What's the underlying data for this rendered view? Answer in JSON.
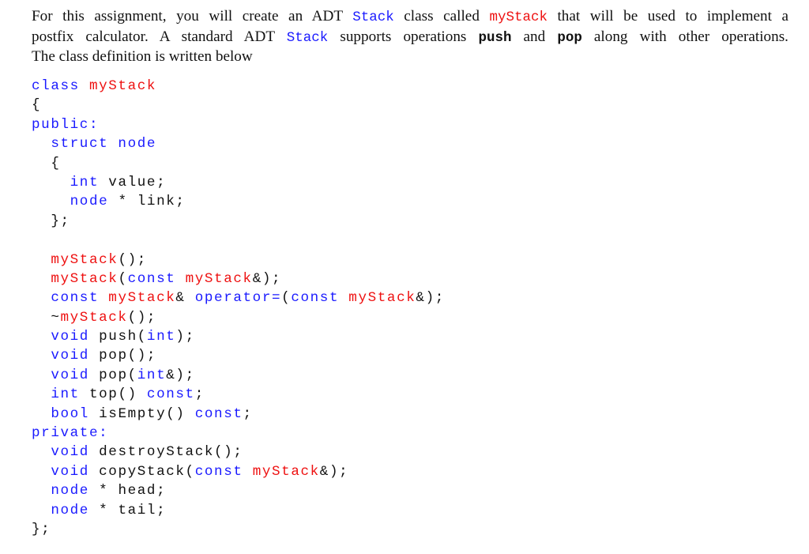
{
  "intro": {
    "line1": [
      {
        "text": "For this assignment, you will create an ADT ",
        "style": "text"
      },
      {
        "text": "Stack",
        "style": "blue"
      },
      {
        "text": " class called ",
        "style": "text"
      },
      {
        "text": "myStack",
        "style": "red"
      },
      {
        "text": " that will be used to implement a",
        "style": "text"
      }
    ],
    "line2": [
      {
        "text": "postfix calculator.  A standard ADT ",
        "style": "text"
      },
      {
        "text": "Stack",
        "style": "blue"
      },
      {
        "text": " supports operations ",
        "style": "text"
      },
      {
        "text": "push",
        "style": "bold"
      },
      {
        "text": " and ",
        "style": "text"
      },
      {
        "text": "pop",
        "style": "bold"
      },
      {
        "text": " along with other operations.",
        "style": "text"
      }
    ],
    "line3": [
      {
        "text": "The class definition is written below",
        "style": "text"
      }
    ]
  },
  "code_lines": [
    [
      {
        "t": "class ",
        "c": "blue"
      },
      {
        "t": "myStack",
        "c": "red"
      }
    ],
    [
      {
        "t": "{",
        "c": "black"
      }
    ],
    [
      {
        "t": "public:",
        "c": "blue"
      }
    ],
    [
      {
        "t": "  ",
        "c": "black"
      },
      {
        "t": "struct node",
        "c": "blue"
      }
    ],
    [
      {
        "t": "  {",
        "c": "black"
      }
    ],
    [
      {
        "t": "    ",
        "c": "black"
      },
      {
        "t": "int",
        "c": "blue"
      },
      {
        "t": " value;",
        "c": "black"
      }
    ],
    [
      {
        "t": "    ",
        "c": "black"
      },
      {
        "t": "node",
        "c": "blue"
      },
      {
        "t": " * link;",
        "c": "black"
      }
    ],
    [
      {
        "t": "  };",
        "c": "black"
      }
    ],
    [
      {
        "t": "",
        "c": "black"
      }
    ],
    [
      {
        "t": "  ",
        "c": "black"
      },
      {
        "t": "myStack",
        "c": "red"
      },
      {
        "t": "();",
        "c": "black"
      }
    ],
    [
      {
        "t": "  ",
        "c": "black"
      },
      {
        "t": "myStack",
        "c": "red"
      },
      {
        "t": "(",
        "c": "black"
      },
      {
        "t": "const",
        "c": "blue"
      },
      {
        "t": " ",
        "c": "black"
      },
      {
        "t": "myStack",
        "c": "red"
      },
      {
        "t": "&);",
        "c": "black"
      }
    ],
    [
      {
        "t": "  ",
        "c": "black"
      },
      {
        "t": "const",
        "c": "blue"
      },
      {
        "t": " ",
        "c": "black"
      },
      {
        "t": "myStack",
        "c": "red"
      },
      {
        "t": "& ",
        "c": "black"
      },
      {
        "t": "operator=",
        "c": "blue"
      },
      {
        "t": "(",
        "c": "black"
      },
      {
        "t": "const",
        "c": "blue"
      },
      {
        "t": " ",
        "c": "black"
      },
      {
        "t": "myStack",
        "c": "red"
      },
      {
        "t": "&);",
        "c": "black"
      }
    ],
    [
      {
        "t": "  ~",
        "c": "black"
      },
      {
        "t": "myStack",
        "c": "red"
      },
      {
        "t": "();",
        "c": "black"
      }
    ],
    [
      {
        "t": "  ",
        "c": "black"
      },
      {
        "t": "void",
        "c": "blue"
      },
      {
        "t": " push(",
        "c": "black"
      },
      {
        "t": "int",
        "c": "blue"
      },
      {
        "t": ");",
        "c": "black"
      }
    ],
    [
      {
        "t": "  ",
        "c": "black"
      },
      {
        "t": "void",
        "c": "blue"
      },
      {
        "t": " pop();",
        "c": "black"
      }
    ],
    [
      {
        "t": "  ",
        "c": "black"
      },
      {
        "t": "void",
        "c": "blue"
      },
      {
        "t": " pop(",
        "c": "black"
      },
      {
        "t": "int",
        "c": "blue"
      },
      {
        "t": "&);",
        "c": "black"
      }
    ],
    [
      {
        "t": "  ",
        "c": "black"
      },
      {
        "t": "int",
        "c": "blue"
      },
      {
        "t": " top() ",
        "c": "black"
      },
      {
        "t": "const",
        "c": "blue"
      },
      {
        "t": ";",
        "c": "black"
      }
    ],
    [
      {
        "t": "  ",
        "c": "black"
      },
      {
        "t": "bool",
        "c": "blue"
      },
      {
        "t": " isEmpty() ",
        "c": "black"
      },
      {
        "t": "const",
        "c": "blue"
      },
      {
        "t": ";",
        "c": "black"
      }
    ],
    [
      {
        "t": "private:",
        "c": "blue"
      }
    ],
    [
      {
        "t": "  ",
        "c": "black"
      },
      {
        "t": "void",
        "c": "blue"
      },
      {
        "t": " destroyStack();",
        "c": "black"
      }
    ],
    [
      {
        "t": "  ",
        "c": "black"
      },
      {
        "t": "void",
        "c": "blue"
      },
      {
        "t": " copyStack(",
        "c": "black"
      },
      {
        "t": "const",
        "c": "blue"
      },
      {
        "t": " ",
        "c": "black"
      },
      {
        "t": "myStack",
        "c": "red"
      },
      {
        "t": "&);",
        "c": "black"
      }
    ],
    [
      {
        "t": "  ",
        "c": "black"
      },
      {
        "t": "node",
        "c": "blue"
      },
      {
        "t": " * head;",
        "c": "black"
      }
    ],
    [
      {
        "t": "  ",
        "c": "black"
      },
      {
        "t": "node",
        "c": "blue"
      },
      {
        "t": " * tail;",
        "c": "black"
      }
    ],
    [
      {
        "t": "};",
        "c": "black"
      }
    ]
  ],
  "colors": {
    "keyword_blue": "#1a1aff",
    "identifier_red": "#ee1111",
    "text": "#111111"
  }
}
